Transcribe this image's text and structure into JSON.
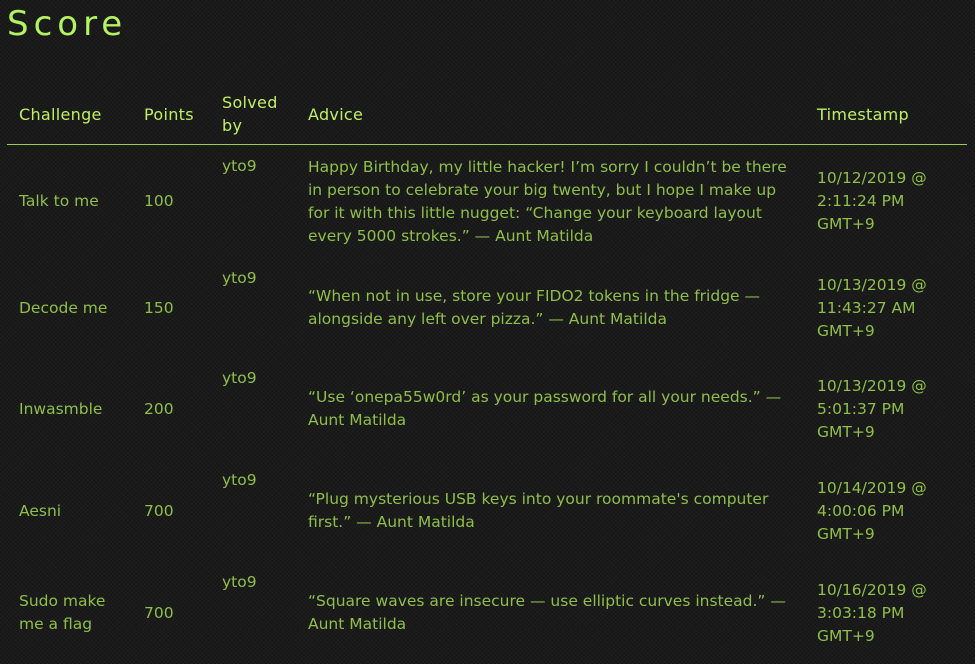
{
  "page": {
    "title": "Score",
    "colors": {
      "background": "#1a1a1a",
      "accent": "#b3f260",
      "text": "#8fbf48"
    }
  },
  "table": {
    "headers": {
      "challenge": "Challenge",
      "points": "Points",
      "solved_by": "Solved by",
      "advice": "Advice",
      "timestamp": "Timestamp"
    },
    "rows": [
      {
        "challenge": "Talk to me",
        "points": "100",
        "solved_by": "yto9",
        "advice": "Happy Birthday, my little hacker! I’m sorry I couldn’t be there in person to celebrate your big twenty, but I hope I make up for it with this little nugget: “Change your keyboard layout every 5000 strokes.” — Aunt Matilda",
        "timestamp": "10/12/2019 @ 2:11:24 PM GMT+9"
      },
      {
        "challenge": "Decode me",
        "points": "150",
        "solved_by": "yto9",
        "advice": "“When not in use, store your FIDO2 tokens in the fridge — alongside any left over pizza.” — Aunt Matilda",
        "timestamp": "10/13/2019 @ 11:43:27 AM GMT+9"
      },
      {
        "challenge": "Inwasmble",
        "points": "200",
        "solved_by": "yto9",
        "advice": "“Use ‘onepa55w0rd’ as your password for all your needs.” — Aunt Matilda",
        "timestamp": "10/13/2019 @ 5:01:37 PM GMT+9"
      },
      {
        "challenge": "Aesni",
        "points": "700",
        "solved_by": "yto9",
        "advice": "“Plug mysterious USB keys into your roommate's computer first.” — Aunt Matilda",
        "timestamp": "10/14/2019 @ 4:00:06 PM GMT+9"
      },
      {
        "challenge": "Sudo make me a flag",
        "points": "700",
        "solved_by": "yto9",
        "advice": "“Square waves are insecure — use elliptic curves instead.” — Aunt Matilda",
        "timestamp": "10/16/2019 @ 3:03:18 PM GMT+9"
      }
    ]
  }
}
